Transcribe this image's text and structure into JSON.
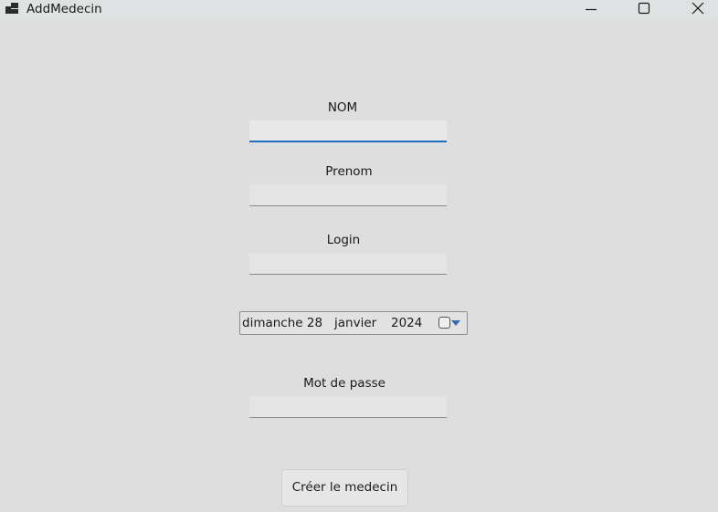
{
  "window": {
    "title": "AddMedecin",
    "icon": "app-window-icon",
    "controls": [
      "minimize-icon",
      "maximize-icon",
      "close-icon"
    ]
  },
  "form": {
    "nom": {
      "label": "NOM",
      "value": ""
    },
    "prenom": {
      "label": "Prenom",
      "value": ""
    },
    "login": {
      "label": "Login",
      "value": ""
    },
    "date": {
      "day": "dimanche 28",
      "month": "janvier",
      "year": "2024",
      "checked": false
    },
    "password": {
      "label": "Mot de passe",
      "value": ""
    },
    "submit_label": "Créer le medecin"
  },
  "colors": {
    "background": "#dedede",
    "focus_accent": "#1d6fc4",
    "dropdown_arrow": "#2f6db4"
  }
}
